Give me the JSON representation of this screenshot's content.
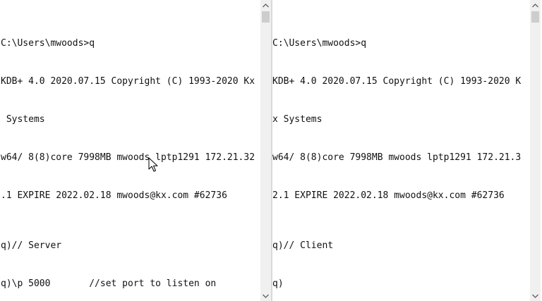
{
  "left_terminal": {
    "lines": [
      "C:\\Users\\mwoods>q",
      "KDB+ 4.0 2020.07.15 Copyright (C) 1993-2020 Kx",
      " Systems",
      "w64/ 8(8)core 7998MB mwoods lptp1291 172.21.32",
      ".1 EXPIRE 2022.02.18 mwoods@kx.com #62736",
      "q)// Server",
      "q)\\p 5000       //set port to listen on"
    ]
  },
  "right_terminal": {
    "lines": [
      "C:\\Users\\mwoods>q",
      "KDB+ 4.0 2020.07.15 Copyright (C) 1993-2020 K",
      "x Systems",
      "w64/ 8(8)core 7998MB mwoods lptp1291 172.21.3",
      "2.1 EXPIRE 2022.02.18 mwoods@kx.com #62736",
      "q)// Client",
      "q)"
    ]
  },
  "icons": {
    "scroll_up": "chevron-up-icon",
    "scroll_down": "chevron-down-icon",
    "pointer": "mouse-pointer-icon"
  },
  "colors": {
    "background": "#ffffff",
    "text": "#111111",
    "scrollbar_track": "#f0f0f0",
    "scrollbar_thumb": "#cdcdcd",
    "divider": "#d9d9d9"
  }
}
